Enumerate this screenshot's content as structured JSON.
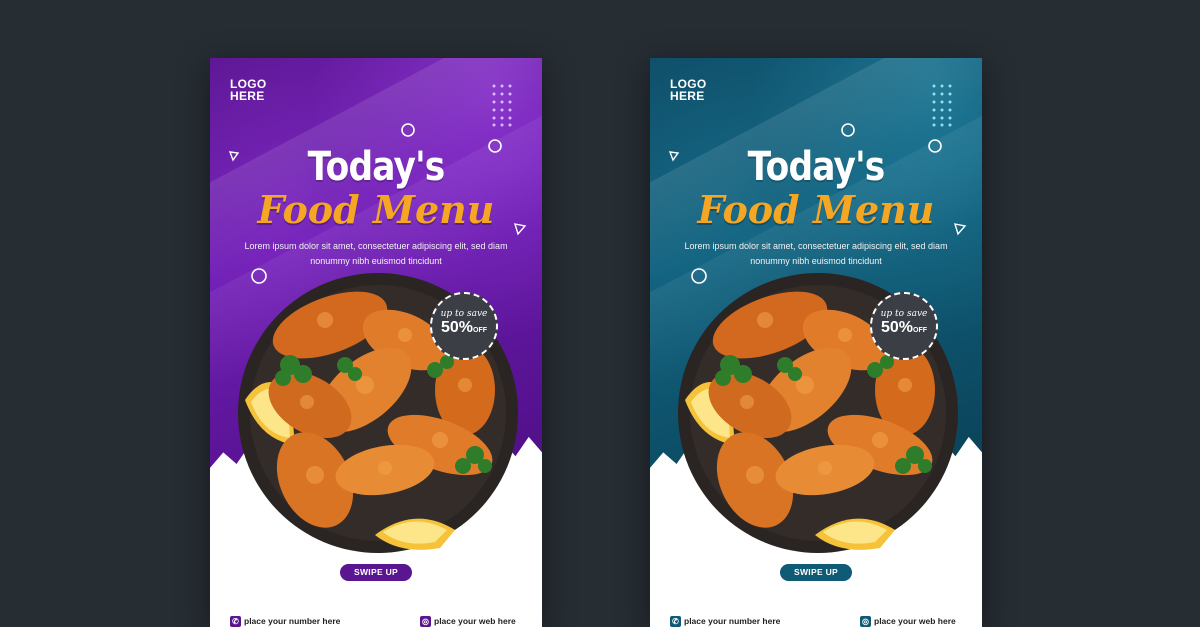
{
  "cards": [
    {
      "theme": "purple",
      "accent": "#5a1590",
      "logo": {
        "line1": "LOGO",
        "line2": "HERE"
      },
      "title_line1": "Today's",
      "title_line2": "Food Menu",
      "description": "Lorem ipsum dolor sit amet, consectetuer adipiscing elit, sed diam nonummy nibh euismod tincidunt",
      "badge": {
        "small": "up to save",
        "big": "50%",
        "suffix": "OFF"
      },
      "swipe_label": "SWIPE UP",
      "phone_text": "place your number here",
      "web_text": "place your web here",
      "phone_icon": "phone-icon",
      "web_icon": "globe-icon"
    },
    {
      "theme": "teal",
      "accent": "#0f5a74",
      "logo": {
        "line1": "LOGO",
        "line2": "HERE"
      },
      "title_line1": "Today's",
      "title_line2": "Food Menu",
      "description": "Lorem ipsum dolor sit amet, consectetuer adipiscing elit, sed diam nonummy nibh euismod tincidunt",
      "badge": {
        "small": "up to save",
        "big": "50%",
        "suffix": "OFF"
      },
      "swipe_label": "SWIPE UP",
      "phone_text": "place your number here",
      "web_text": "place your web here",
      "phone_icon": "phone-icon",
      "web_icon": "globe-icon"
    }
  ]
}
